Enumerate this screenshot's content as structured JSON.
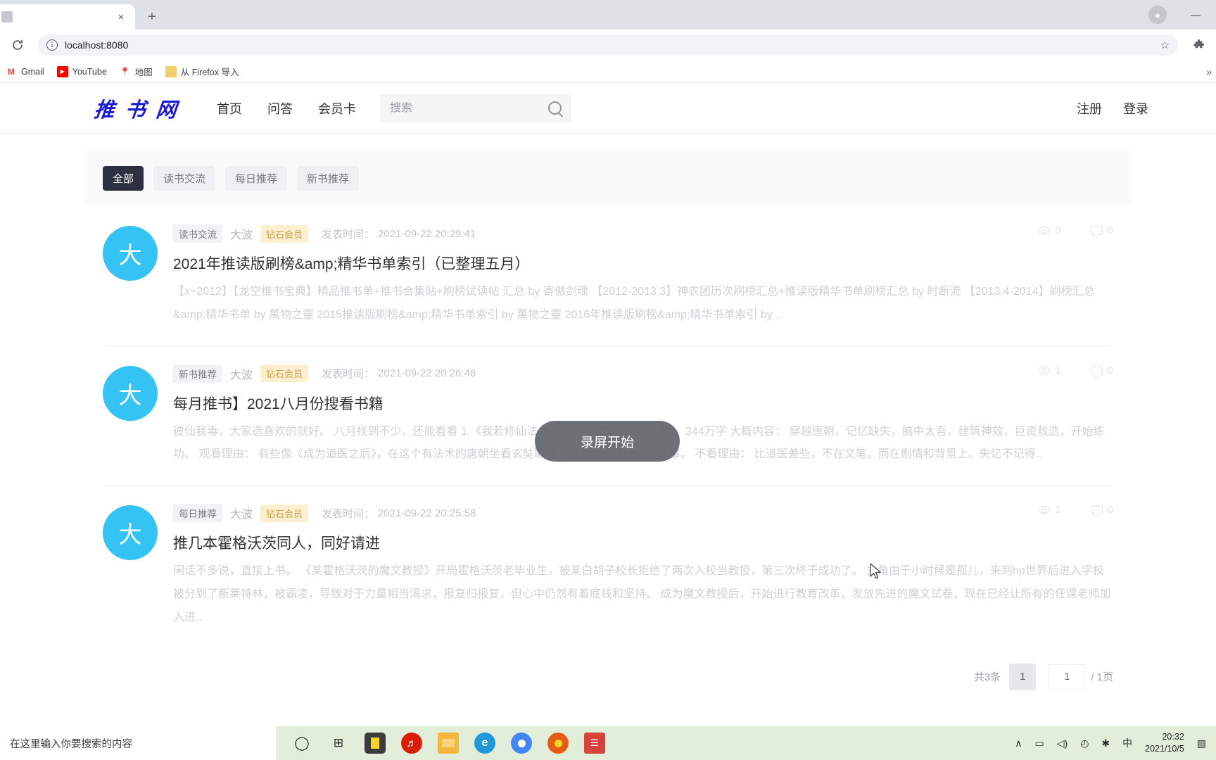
{
  "browser": {
    "tab_title": "",
    "new_tab_label": "+",
    "close_label": "×",
    "reload_icon": "reload-icon",
    "url": "localhost:8080",
    "star_label": "☆",
    "minimize_label": "—",
    "maximize_label": "□",
    "window_close_label": "×",
    "profile_label": "●",
    "extensions_label": "🧩",
    "bookmarks": [
      {
        "label": "Gmail",
        "icon": "M",
        "color": "#ea4335"
      },
      {
        "label": "YouTube",
        "icon": "▶",
        "color": "#ff0000"
      },
      {
        "label": "地图",
        "icon": "📍",
        "color": "#34a853"
      },
      {
        "label": "从 Firefox 导入",
        "icon": "▮",
        "color": "#f2cd6b"
      }
    ],
    "bookmarks_overflow": "»"
  },
  "site": {
    "logo_chars": [
      "推",
      "书",
      "网"
    ],
    "logo_color": "#1a1ad6",
    "nav": [
      {
        "label": "首页"
      },
      {
        "label": "问答"
      },
      {
        "label": "会员卡"
      }
    ],
    "search": {
      "value": "",
      "placeholder": "搜索"
    },
    "auth": [
      {
        "label": "注册"
      },
      {
        "label": "登录"
      }
    ]
  },
  "filters": [
    {
      "label": "全部",
      "active": true
    },
    {
      "label": "读书交流",
      "active": false
    },
    {
      "label": "每日推荐",
      "active": false
    },
    {
      "label": "新书推荐",
      "active": false
    }
  ],
  "posts": [
    {
      "avatar": "大",
      "category": "读书交流",
      "author": "大波",
      "badge": "钻石会员",
      "time_label": "发表时间：",
      "time": "2021-09-22 20:29:41",
      "title": "2021年推读版刷榜&amp;精华书单索引（已整理五月）",
      "excerpt": "【x~2012】【龙空推书宝典】精品推书单+推书合集贴+刷榜试读帖 汇总 by 寄傲剑魂 【2012-2013.3】神农团历次刷榜汇总+推读版精华书单刷榜汇总 by 时断流 【2013.4-2014】刷榜汇总&amp;精华书单 by 萬物之靈 2015推读版刷榜&amp;精华书单索引 by 萬物之靈 2016年推读版刷榜&amp;精华书单索引 by ..",
      "views": "0",
      "comments": "0"
    },
    {
      "avatar": "大",
      "category": "新书推荐",
      "author": "大波",
      "badge": "钻石会员",
      "time_label": "发表时间：",
      "time": "2021-09-22 20:26:48",
      "title": "每月推书】2021八月份搜看书籍",
      "excerpt": "彼仙我毒，大家选喜欢的就好。 八月找到不少，还能看看 1.《我若修仙法力齐天》 状态： 连载 字数： 344万字 大概内容： 穿越唐朝，记忆缺失，脑中太吾，建筑神效，巨资敖造，开始练功。 观看理由： 有些像《成为道医之后》，在这个有法术的唐朝坐看玄奘取经，自己修炼要成仙的故事。 不看理由： 比道医差些，不在文笔，而在剧情和背景上。失忆不记得..",
      "views": "1",
      "comments": "0"
    },
    {
      "avatar": "大",
      "category": "每日推荐",
      "author": "大波",
      "badge": "钻石会员",
      "time_label": "发表时间：",
      "time": "2021-09-22 20:25:58",
      "title": "推几本霍格沃茨同人，同好请进",
      "excerpt": "闲话不多说，直接上书。 《某霍格沃茨的魔文教授》开局霍格沃茨老毕业生，被某白胡子校长拒绝了两次入校当教授，第三次终于成功了。 主角由于小时候是孤儿，来到hp世界后进入学校被分到了斯莱特林，被霸凌，导致对于力量相当渴求，报复归报复，但心中仍然有着底线和坚持。 成为魔文教授后，开始进行教育改革，发放先进的魔文试卷，现在已经让所有的任课老师加入进..",
      "views": "1",
      "comments": "0"
    }
  ],
  "pagination": {
    "total_label": "共3条",
    "current_page": "1",
    "jump_value": "1",
    "of_label": "/ 1页"
  },
  "overlay": {
    "record_button": "录屏开始"
  },
  "taskbar": {
    "search_placeholder": "在这里输入你要搜索的内容",
    "apps": [
      {
        "name": "cortana-icon",
        "glyph": "○",
        "color": "transparent",
        "fg": "#1f1f1f"
      },
      {
        "name": "task-view-icon",
        "glyph": "⌸",
        "color": "transparent",
        "fg": "#1f1f1f"
      },
      {
        "name": "sticky-notes-icon",
        "glyph": "▤",
        "color": "#3b3b3b",
        "fg": "#f6d32d"
      },
      {
        "name": "netease-music-icon",
        "glyph": "♫",
        "color": "#d81e06",
        "fg": "#ffffff"
      },
      {
        "name": "file-explorer-icon",
        "glyph": "█",
        "color": "#f0b429",
        "fg": "#f6c453"
      },
      {
        "name": "edge-icon",
        "glyph": "e",
        "color": "#1f9ad6",
        "fg": "#ffffff"
      },
      {
        "name": "chrome-icon",
        "glyph": "●",
        "color": "#4285f4",
        "fg": "#ffffff"
      },
      {
        "name": "firefox-icon",
        "glyph": "●",
        "color": "#e55b12",
        "fg": "#ffffff"
      },
      {
        "name": "app-icon",
        "glyph": "☰",
        "color": "#d6423c",
        "fg": "#ffffff"
      }
    ],
    "tray": {
      "chevron": "∧",
      "battery": "▭",
      "volume": "◁)",
      "network": "◴",
      "bluetooth": "✱",
      "ime": "中",
      "time": "20:32",
      "date": "2021/10/5",
      "notifications": "▧"
    }
  }
}
